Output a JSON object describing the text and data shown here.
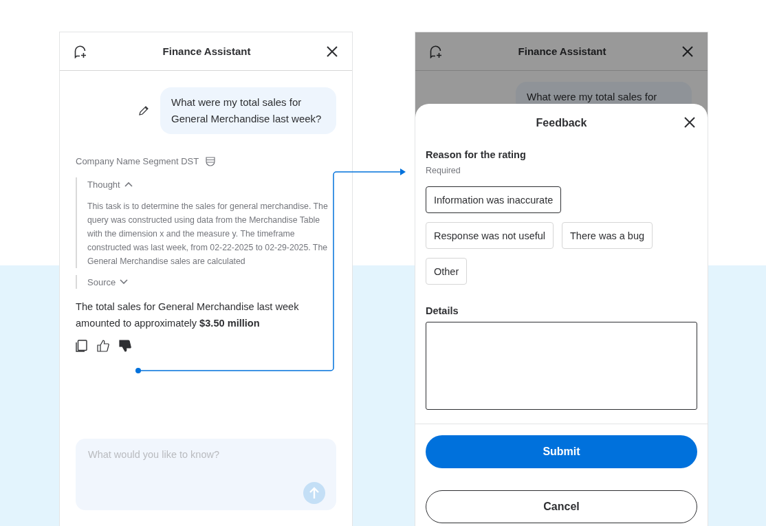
{
  "chat_panel": {
    "title": "Finance Assistant",
    "question": "What were my total sales for General Merchandise last week?",
    "source_label": "Company Name Segment DST",
    "sections": [
      {
        "label": "Thought",
        "expanded": true,
        "body": "This task is to determine the sales for general merchandise. The query was constructed using data from the Merchandise Table with the dimension x and the measure y. The timeframe constructed was last week, from 02-22-2025 to 02-29-2025. The General Merchandise sales are calculated"
      },
      {
        "label": "Source",
        "expanded": false
      }
    ],
    "answer": "The total sales for General Merchandise last week amounted to approximately **$3.50 million**",
    "thumbs_down_selected": true,
    "input": {
      "placeholder": "What would you like to know?"
    }
  },
  "feedback_panel": {
    "backdrop_title": "Finance Assistant",
    "backdrop_question": "What were my total sales for",
    "title": "Feedback",
    "reason_label": "Reason for the rating",
    "reason_hint": "Required",
    "reasons": [
      {
        "label": "Information was inaccurate",
        "selected": true
      },
      {
        "label": "Response was not useful",
        "selected": false
      },
      {
        "label": "There was a bug",
        "selected": false
      },
      {
        "label": "Other",
        "selected": false
      }
    ],
    "details_label": "Details",
    "buttons": [
      {
        "kind": "primary",
        "label": "Submit"
      },
      {
        "kind": "secondary",
        "label": "Cancel"
      }
    ]
  }
}
